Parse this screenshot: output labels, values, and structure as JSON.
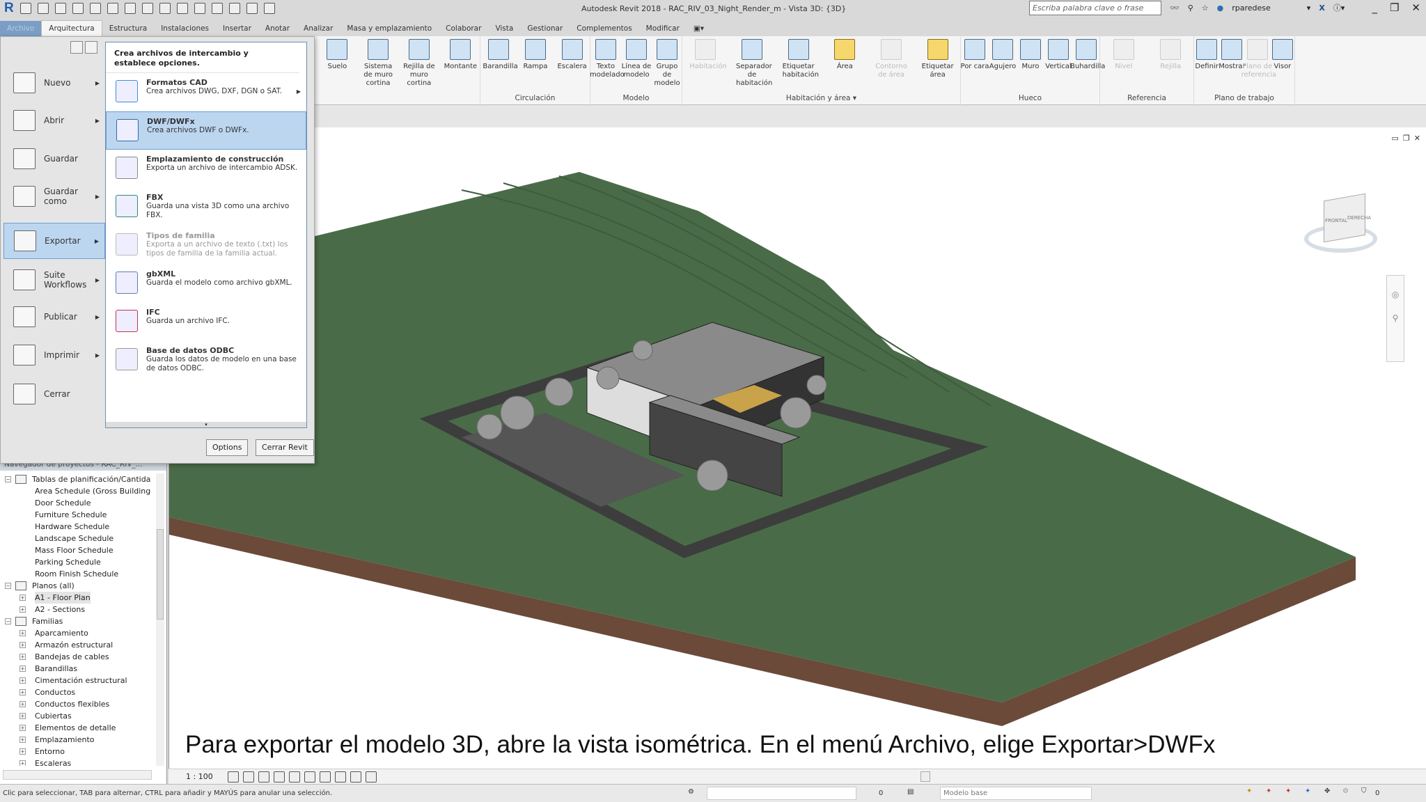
{
  "titlebar": {
    "app_title": "Autodesk Revit 2018 -   RAC_RIV_03_Night_Render_m - Vista 3D: {3D}",
    "search_placeholder": "Escriba palabra clave o frase",
    "user": "rparedese"
  },
  "tabs": [
    "Archivo",
    "Arquitectura",
    "Estructura",
    "Instalaciones",
    "Insertar",
    "Anotar",
    "Analizar",
    "Masa y emplazamiento",
    "Colaborar",
    "Vista",
    "Gestionar",
    "Complementos",
    "Modificar"
  ],
  "ribbon": [
    {
      "label": "",
      "items": [
        {
          "l": "Suelo"
        },
        {
          "l": "Sistema de muro cortina"
        },
        {
          "l": "Rejilla de muro cortina"
        },
        {
          "l": "Montante"
        }
      ]
    },
    {
      "label": "Circulación",
      "items": [
        {
          "l": "Barandilla"
        },
        {
          "l": "Rampa"
        },
        {
          "l": "Escalera"
        }
      ]
    },
    {
      "label": "Modelo",
      "items": [
        {
          "l": "Texto modelado"
        },
        {
          "l": "Línea de modelo"
        },
        {
          "l": "Grupo de modelo"
        }
      ]
    },
    {
      "label": "Habitación y área ▾",
      "items": [
        {
          "l": "Habitación",
          "d": true
        },
        {
          "l": "Separador de habitación"
        },
        {
          "l": "Etiquetar habitación"
        },
        {
          "l": "Área",
          "y": true
        },
        {
          "l": "Contorno de área",
          "d": true
        },
        {
          "l": "Etiquetar área",
          "y": true
        }
      ]
    },
    {
      "label": "Hueco",
      "items": [
        {
          "l": "Por cara"
        },
        {
          "l": "Agujero"
        },
        {
          "l": "Muro"
        },
        {
          "l": "Vertical"
        },
        {
          "l": "Buhardilla"
        }
      ]
    },
    {
      "label": "Referencia",
      "items": [
        {
          "l": "Nivel",
          "d": true
        },
        {
          "l": "Rejilla",
          "d": true
        }
      ]
    },
    {
      "label": "Plano de trabajo",
      "items": [
        {
          "l": "Definir"
        },
        {
          "l": "Mostrar"
        },
        {
          "l": "Plano de referencia",
          "d": true
        },
        {
          "l": "Visor"
        }
      ]
    }
  ],
  "appmenu": {
    "left": [
      {
        "l": "Nuevo",
        "a": true
      },
      {
        "l": "Abrir",
        "a": true
      },
      {
        "l": "Guardar",
        "a": false
      },
      {
        "l": "Guardar como",
        "a": true
      },
      {
        "l": "Exportar",
        "a": true,
        "active": true
      },
      {
        "l": "Suite Workflows",
        "a": true
      },
      {
        "l": "Publicar",
        "a": true
      },
      {
        "l": "Imprimir",
        "a": true
      },
      {
        "l": "Cerrar",
        "a": false
      }
    ],
    "header": "Crea archivos de intercambio y establece opciones.",
    "items": [
      {
        "t": "Formatos CAD",
        "d": "Crea archivos DWG, DXF, DGN o SAT.",
        "sub": true
      },
      {
        "t": "DWF/DWFx",
        "d": "Crea archivos DWF o DWFx.",
        "active": true
      },
      {
        "t": "Emplazamiento de construcción",
        "d": "Exporta un archivo de intercambio ADSK."
      },
      {
        "t": "FBX",
        "d": "Guarda una vista 3D como una archivo FBX."
      },
      {
        "t": "Tipos de familia",
        "d": "Exporta a un archivo de texto (.txt) los tipos de familia de la familia actual.",
        "dis": true
      },
      {
        "t": "gbXML",
        "d": "Guarda el modelo como archivo gbXML."
      },
      {
        "t": "IFC",
        "d": "Guarda un archivo IFC."
      },
      {
        "t": "Base de datos ODBC",
        "d": "Guarda los datos de modelo en una base de datos ODBC."
      }
    ],
    "options_label": "Options",
    "exit_label": "Cerrar Revit"
  },
  "browser": {
    "title": "Navegador de proyectos - RAC_RIV_...",
    "nodes": [
      {
        "l": "Tablas de planificación/Cantida",
        "lvl": 0,
        "pm": "−"
      },
      {
        "l": "Area Schedule (Gross Building",
        "lvl": 1
      },
      {
        "l": "Door Schedule",
        "lvl": 1
      },
      {
        "l": "Furniture Schedule",
        "lvl": 1
      },
      {
        "l": "Hardware Schedule",
        "lvl": 1
      },
      {
        "l": "Landscape Schedule",
        "lvl": 1
      },
      {
        "l": "Mass Floor Schedule",
        "lvl": 1
      },
      {
        "l": "Parking Schedule",
        "lvl": 1
      },
      {
        "l": "Room Finish Schedule",
        "lvl": 1
      },
      {
        "l": "Planos (all)",
        "lvl": 0,
        "pm": "−"
      },
      {
        "l": "A1 - Floor Plan",
        "lvl": 1,
        "pm": "+",
        "sel": true
      },
      {
        "l": "A2 - Sections",
        "lvl": 1,
        "pm": "+"
      },
      {
        "l": "Familias",
        "lvl": 0,
        "pm": "−"
      },
      {
        "l": "Aparcamiento",
        "lvl": 1,
        "pm": "+"
      },
      {
        "l": "Armazón estructural",
        "lvl": 1,
        "pm": "+"
      },
      {
        "l": "Bandejas de cables",
        "lvl": 1,
        "pm": "+"
      },
      {
        "l": "Barandillas",
        "lvl": 1,
        "pm": "+"
      },
      {
        "l": "Cimentación estructural",
        "lvl": 1,
        "pm": "+"
      },
      {
        "l": "Conductos",
        "lvl": 1,
        "pm": "+"
      },
      {
        "l": "Conductos flexibles",
        "lvl": 1,
        "pm": "+"
      },
      {
        "l": "Cubiertas",
        "lvl": 1,
        "pm": "+"
      },
      {
        "l": "Elementos de detalle",
        "lvl": 1,
        "pm": "+"
      },
      {
        "l": "Emplazamiento",
        "lvl": 1,
        "pm": "+"
      },
      {
        "l": "Entorno",
        "lvl": 1,
        "pm": "+"
      },
      {
        "l": "Escaleras",
        "lvl": 1,
        "pm": "+"
      }
    ]
  },
  "viewcube": {
    "front": "FRONTAL",
    "right": "DERECHA"
  },
  "viewbar": {
    "scale": "1 : 100"
  },
  "statusbar": {
    "hint": "Clic para seleccionar, TAB para alternar, CTRL para añadir y MAYÚS para anular una selección.",
    "count1": "0",
    "count2": "0",
    "model": "Modelo base"
  },
  "caption": "Para exportar el modelo 3D, abre la vista isométrica. En el menú Archivo, elige Exportar>DWFx",
  "colors": {
    "terrain": "#4a6b48",
    "soil": "#6b4a3a",
    "road": "#3d3d3d",
    "accent": "#2e6fb5",
    "highlight": "#bcd6f0"
  }
}
